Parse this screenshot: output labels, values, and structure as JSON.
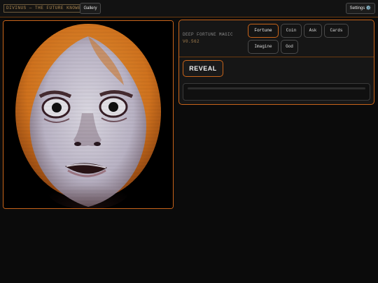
{
  "header": {
    "title": "DIVINUS — THE FUTURE KNOWER",
    "gallery_label": "Gallery",
    "settings_label": "Settings ⚙️"
  },
  "controls": {
    "brand_line": "DEEP FORTUNE MAGIC",
    "version": "V0.562",
    "modes": [
      {
        "label": "Fortune",
        "active": true
      },
      {
        "label": "Coin",
        "active": false
      },
      {
        "label": "Ask",
        "active": false
      },
      {
        "label": "Cards",
        "active": false
      },
      {
        "label": "Imagine",
        "active": false
      },
      {
        "label": "God",
        "active": false
      }
    ],
    "reveal_label": "REVEAL"
  },
  "output": {
    "text": ""
  },
  "colors": {
    "accent": "#c8641a",
    "background": "#0b0b0b",
    "panel": "#161616",
    "hair": "#e8892a",
    "skin": "#d9d6e6"
  }
}
